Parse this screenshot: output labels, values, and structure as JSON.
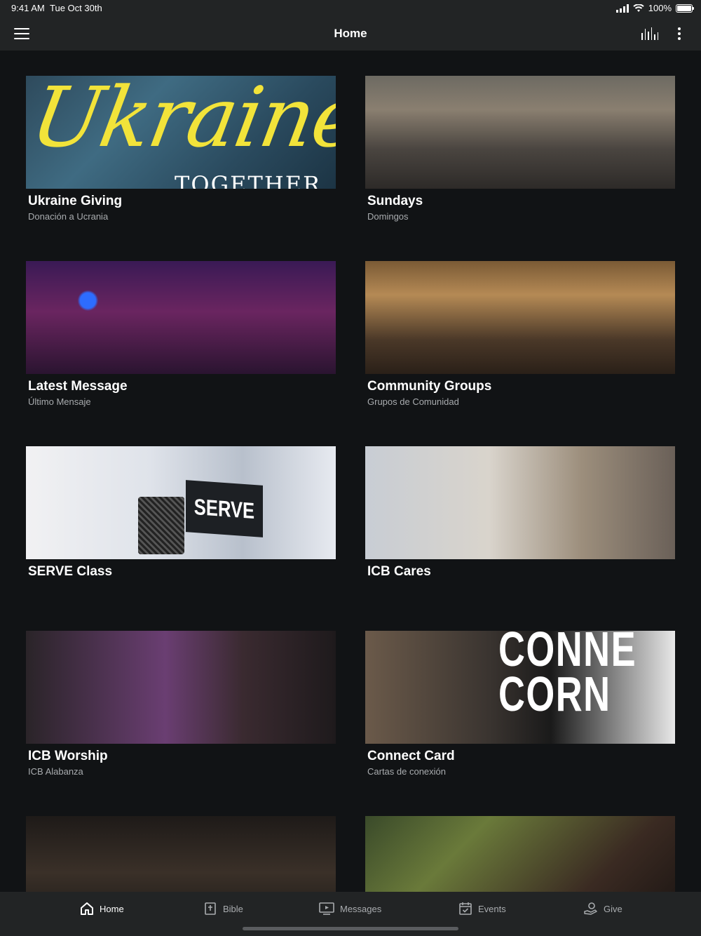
{
  "status_bar": {
    "time": "9:41 AM",
    "date": "Tue Oct 30th",
    "battery": "100%"
  },
  "nav": {
    "title": "Home"
  },
  "cards": [
    {
      "title": "Ukraine Giving",
      "subtitle": "Donación a Ucrania",
      "image_text_script": "Ukraine",
      "image_text_caption": "TOGETHER"
    },
    {
      "title": "Sundays",
      "subtitle": "Domingos"
    },
    {
      "title": "Latest Message",
      "subtitle": "Último Mensaje"
    },
    {
      "title": "Community Groups",
      "subtitle": "Grupos de Comunidad"
    },
    {
      "title": "SERVE Class",
      "subtitle": "",
      "image_text": "SERVE"
    },
    {
      "title": "ICB Cares",
      "subtitle": ""
    },
    {
      "title": "ICB Worship",
      "subtitle": "ICB Alabanza"
    },
    {
      "title": "Connect Card",
      "subtitle": "Cartas de conexión",
      "image_text": "CONNE\nCORN"
    }
  ],
  "tabs": [
    {
      "label": "Home",
      "icon": "home-icon",
      "active": true
    },
    {
      "label": "Bible",
      "icon": "bible-icon",
      "active": false
    },
    {
      "label": "Messages",
      "icon": "messages-icon",
      "active": false
    },
    {
      "label": "Events",
      "icon": "events-icon",
      "active": false
    },
    {
      "label": "Give",
      "icon": "give-icon",
      "active": false
    }
  ]
}
